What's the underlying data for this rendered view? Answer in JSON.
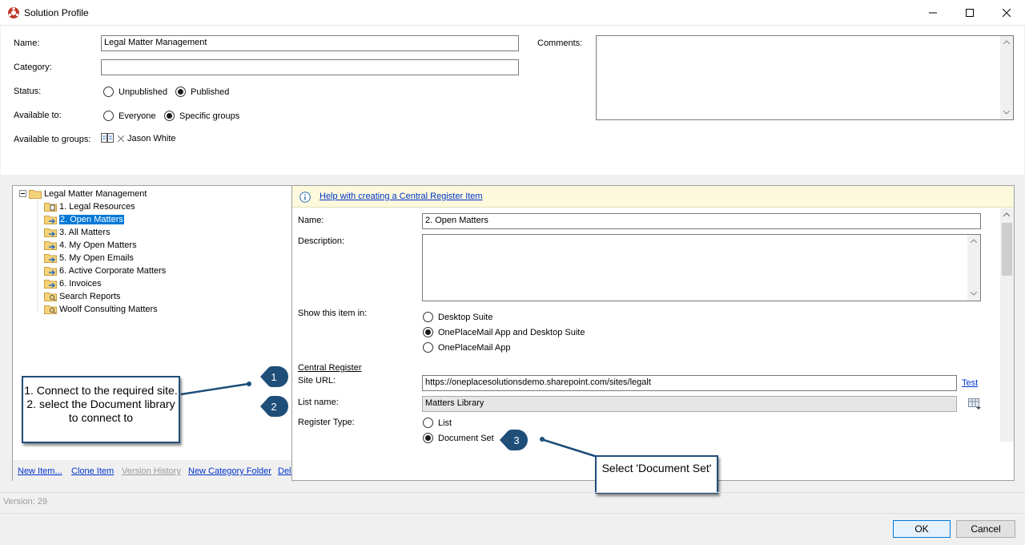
{
  "window": {
    "title": "Solution Profile"
  },
  "form": {
    "name_label": "Name:",
    "name_value": "Legal Matter Management",
    "category_label": "Category:",
    "category_value": "",
    "status_label": "Status:",
    "status_options": [
      "Unpublished",
      "Published"
    ],
    "status_selected": "Published",
    "available_label": "Available to:",
    "available_options": [
      "Everyone",
      "Specific groups"
    ],
    "available_selected": "Specific groups",
    "groups_label": "Available to groups:",
    "group_member": "Jason White",
    "comments_label": "Comments:",
    "comments_value": ""
  },
  "tree": {
    "root": "Legal Matter Management",
    "items": [
      "1. Legal Resources",
      "2. Open Matters",
      "3. All Matters",
      "4. My Open Matters",
      "5. My Open Emails",
      "6. Active Corporate Matters",
      "6. Invoices",
      "Search Reports",
      "Woolf Consulting Matters"
    ],
    "selected": "2. Open Matters"
  },
  "actions": {
    "new_item": "New Item...",
    "clone_item": "Clone Item",
    "version_history": "Version History",
    "new_category_folder": "New Category Folder",
    "delete": "Delete"
  },
  "detail": {
    "help_link": "Help with creating a Central Register Item",
    "name_label": "Name:",
    "name_value": "2. Open Matters",
    "description_label": "Description:",
    "description_value": "",
    "show_label": "Show this item in:",
    "show_options": [
      "Desktop Suite",
      "OnePlaceMail App and Desktop Suite",
      "OnePlaceMail App"
    ],
    "show_selected": "OnePlaceMail App and Desktop Suite",
    "section_title": "Central Register",
    "site_url_label": "Site URL:",
    "site_url_value": "https://oneplacesolutionsdemo.sharepoint.com/sites/legalt",
    "test_link": "Test",
    "list_name_label": "List name:",
    "list_name_value": "Matters Library",
    "register_type_label": "Register Type:",
    "register_options": [
      "List",
      "Document Set"
    ],
    "register_selected": "Document Set"
  },
  "callouts": {
    "c1": "1. Connect to the required site.\n2. select the Document library to connect to",
    "c2": "Select 'Document Set'",
    "badge1": "1",
    "badge2": "2",
    "badge3": "3"
  },
  "footer": {
    "version": "Version: 29",
    "ok": "OK",
    "cancel": "Cancel"
  },
  "colors": {
    "accent": "#0078d7",
    "callout_border": "#1f4e79",
    "help_bar": "#fcf9dc"
  }
}
